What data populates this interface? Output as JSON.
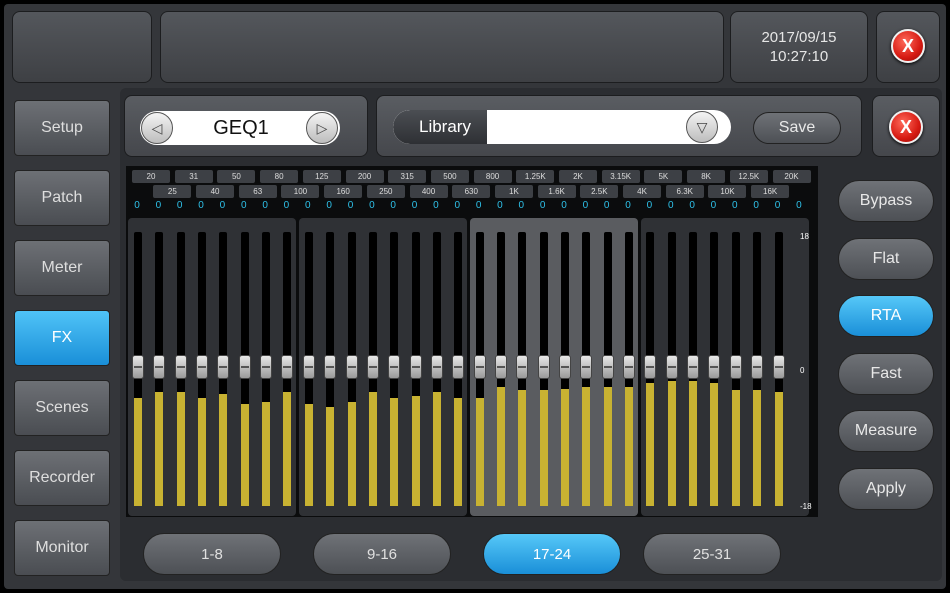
{
  "header": {
    "date": "2017/09/15",
    "time": "10:27:10",
    "close_label": "X"
  },
  "sidebar": {
    "items": [
      {
        "label": "Setup",
        "active": false
      },
      {
        "label": "Patch",
        "active": false
      },
      {
        "label": "Meter",
        "active": false
      },
      {
        "label": "FX",
        "active": true
      },
      {
        "label": "Scenes",
        "active": false
      },
      {
        "label": "Recorder",
        "active": false
      },
      {
        "label": "Monitor",
        "active": false
      }
    ]
  },
  "fx": {
    "name": "GEQ1",
    "prev_icon": "left-triangle-icon",
    "next_icon": "right-triangle-icon",
    "library_label": "Library",
    "library_value": "",
    "save_label": "Save",
    "close_label": "X"
  },
  "eq": {
    "freq_top": [
      "20",
      "31",
      "50",
      "80",
      "125",
      "200",
      "315",
      "500",
      "800",
      "1.25K",
      "2K",
      "3.15K",
      "5K",
      "8K",
      "12.5K",
      "20K"
    ],
    "freq_bottom": [
      "25",
      "40",
      "63",
      "100",
      "160",
      "250",
      "400",
      "630",
      "1K",
      "1.6K",
      "2.5K",
      "4K",
      "6.3K",
      "10K",
      "16K"
    ],
    "values": [
      "0",
      "0",
      "0",
      "0",
      "0",
      "0",
      "0",
      "0",
      "0",
      "0",
      "0",
      "0",
      "0",
      "0",
      "0",
      "0",
      "0",
      "0",
      "0",
      "0",
      "0",
      "0",
      "0",
      "0",
      "0",
      "0",
      "0",
      "0",
      "0",
      "0",
      "0",
      "0"
    ],
    "scale": {
      "max": "18",
      "mid": "0",
      "min": "-18"
    },
    "rta_levels": [
      0.58,
      0.61,
      0.61,
      0.58,
      0.6,
      0.55,
      0.56,
      0.61,
      0.55,
      0.53,
      0.56,
      0.61,
      0.58,
      0.59,
      0.61,
      0.58,
      0.58,
      0.64,
      0.62,
      0.62,
      0.63,
      0.64,
      0.64,
      0.64,
      0.66,
      0.67,
      0.67,
      0.66,
      0.62,
      0.62,
      0.61
    ],
    "fader_levels": 0.5
  },
  "side_buttons": [
    {
      "label": "Bypass",
      "active": false
    },
    {
      "label": "Flat",
      "active": false
    },
    {
      "label": "RTA",
      "active": true
    },
    {
      "label": "Fast",
      "active": false
    },
    {
      "label": "Measure",
      "active": false
    },
    {
      "label": "Apply",
      "active": false
    }
  ],
  "pages": [
    {
      "label": "1-8",
      "active": false
    },
    {
      "label": "9-16",
      "active": false
    },
    {
      "label": "17-24",
      "active": true
    },
    {
      "label": "25-31",
      "active": false
    }
  ],
  "colors": {
    "accent": "#1a8fd8",
    "level": "#c8b232",
    "value": "#2ec0e8",
    "close": "#d61a12"
  }
}
